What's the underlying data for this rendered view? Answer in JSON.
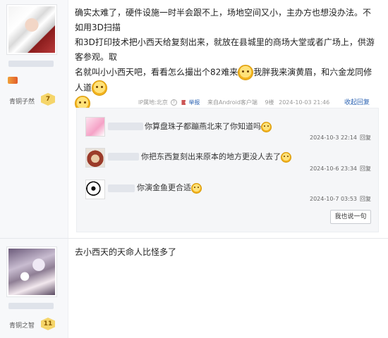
{
  "post1": {
    "text_line1": "确实太难了，硬件设施一时半会跟不上，场地空间又小，主办方也想没办法。不如用3D扫描",
    "text_line2": "和3D打印技术把小西天给复刻出来，就放在县城里的商场大堂或者广场上，供游客参观。取",
    "text_line3_a": "名就叫小小西天吧，看看怎么撮出个82难来",
    "text_line3_b": "我胖我来演黄眉，和六金龙同修人道",
    "rank_label": "青铜子然",
    "level": "7",
    "meta": {
      "ip": "IP属地:北京",
      "help": "?",
      "report": "举报",
      "client": "来自Android客户端",
      "floor": "9楼",
      "time": "2024-10-03 21:46"
    },
    "collapse_label": "收起回复"
  },
  "replies": [
    {
      "text": "你算盘珠子都蹦燕北来了你知道吗",
      "time": "2024-10-3 22:14",
      "action": "回复"
    },
    {
      "text": "你把东西复刻出来原本的地方更没人去了",
      "time": "2024-10-6 23:34",
      "action": "回复"
    },
    {
      "text": "你演金鱼更合适",
      "time": "2024-10-7 03:53",
      "action": "回复"
    }
  ],
  "say_button": "我也说一句",
  "post2": {
    "text": "去小西天的天命人比怪多了",
    "rank_label": "青铜之智",
    "level": "11"
  },
  "icons": {
    "emoji": "smiley-face-icon",
    "report": "report-flag-icon",
    "help": "help-circle-icon",
    "level": "level-badge-icon"
  }
}
